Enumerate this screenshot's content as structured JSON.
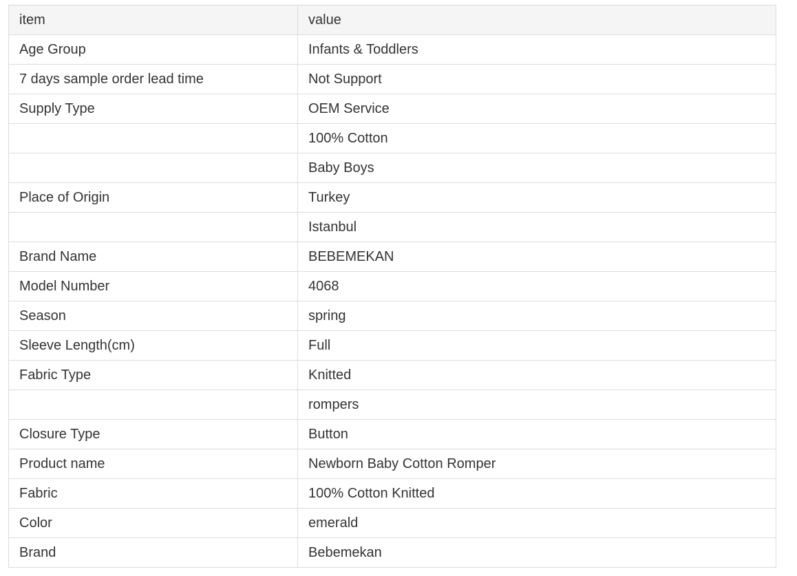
{
  "table": {
    "header": {
      "item": "item",
      "value": "value"
    },
    "rows": [
      {
        "item": "Age Group",
        "value": "Infants & Toddlers"
      },
      {
        "item": "7 days sample order lead time",
        "value": "Not Support"
      },
      {
        "item": "Supply Type",
        "value": "OEM Service"
      },
      {
        "item": "",
        "value": "100% Cotton"
      },
      {
        "item": "",
        "value": "Baby Boys"
      },
      {
        "item": "Place of Origin",
        "value": "Turkey"
      },
      {
        "item": "",
        "value": "Istanbul"
      },
      {
        "item": "Brand Name",
        "value": "BEBEMEKAN"
      },
      {
        "item": "Model Number",
        "value": "4068"
      },
      {
        "item": "Season",
        "value": "spring"
      },
      {
        "item": "Sleeve Length(cm)",
        "value": "Full"
      },
      {
        "item": "Fabric Type",
        "value": "Knitted"
      },
      {
        "item": "",
        "value": "rompers"
      },
      {
        "item": "Closure Type",
        "value": "Button"
      },
      {
        "item": "Product name",
        "value": "Newborn Baby Cotton Romper"
      },
      {
        "item": "Fabric",
        "value": "100% Cotton Knitted"
      },
      {
        "item": "Color",
        "value": "emerald"
      },
      {
        "item": "Brand",
        "value": "Bebemekan"
      }
    ]
  },
  "colors": {
    "header_background": "#f5f5f5",
    "border": "#dcdcdc",
    "text": "#333333"
  }
}
